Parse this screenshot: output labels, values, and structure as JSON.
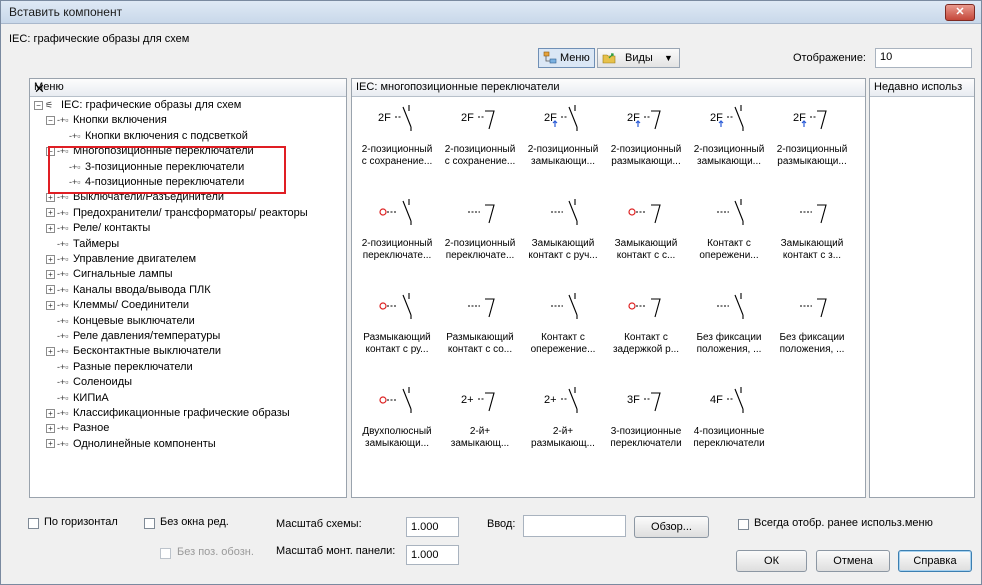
{
  "window": {
    "title": "Вставить компонент",
    "close_glyph": "✕"
  },
  "header": {
    "library_label": "IEC: графические образы для схем",
    "menu_button": "Меню",
    "views_button": "Виды",
    "display_label": "Отображение:",
    "display_value": "10"
  },
  "menu_panel": {
    "title": "Меню",
    "close_glyph": "✕",
    "items": [
      {
        "label": "IEC: графические образы для схем",
        "level": 0,
        "exp": "−"
      },
      {
        "label": "Кнопки включения",
        "level": 1,
        "exp": "−"
      },
      {
        "label": "Кнопки включения с подсветкой",
        "level": 2,
        "exp": ""
      },
      {
        "label": "Многопозиционные переключатели",
        "level": 1,
        "exp": "−"
      },
      {
        "label": "3-позиционные переключатели",
        "level": 2,
        "exp": ""
      },
      {
        "label": "4-позиционные переключатели",
        "level": 2,
        "exp": ""
      },
      {
        "label": "Выключатели/Разъединители",
        "level": 1,
        "exp": "+"
      },
      {
        "label": "Предохранители/ трансформаторы/ реакторы",
        "level": 1,
        "exp": "+"
      },
      {
        "label": "Реле/ контакты",
        "level": 1,
        "exp": "+"
      },
      {
        "label": "Таймеры",
        "level": 1,
        "exp": ""
      },
      {
        "label": "Управление двигателем",
        "level": 1,
        "exp": "+"
      },
      {
        "label": "Сигнальные лампы",
        "level": 1,
        "exp": "+"
      },
      {
        "label": "Каналы ввода/вывода ПЛК",
        "level": 1,
        "exp": "+"
      },
      {
        "label": "Клеммы/ Соединители",
        "level": 1,
        "exp": "+"
      },
      {
        "label": "Концевые выключатели",
        "level": 1,
        "exp": ""
      },
      {
        "label": "Реле давления/температуры",
        "level": 1,
        "exp": ""
      },
      {
        "label": "Бесконтактные выключатели",
        "level": 1,
        "exp": "+"
      },
      {
        "label": "Разные переключатели",
        "level": 1,
        "exp": ""
      },
      {
        "label": "Соленоиды",
        "level": 1,
        "exp": ""
      },
      {
        "label": "КИПиА",
        "level": 1,
        "exp": ""
      },
      {
        "label": "Классификационные графические образы",
        "level": 1,
        "exp": "+"
      },
      {
        "label": "Разное",
        "level": 1,
        "exp": "+"
      },
      {
        "label": "Однолинейные компоненты",
        "level": 1,
        "exp": "+"
      }
    ]
  },
  "gallery": {
    "title": "IEC: многопозиционные переключатели",
    "tiles": [
      {
        "line1": "2-позиционный",
        "line2": "с сохранение...",
        "icon": "switch-2pos-retain-nc-icon",
        "sym": "2F"
      },
      {
        "line1": "2-позиционный",
        "line2": "с сохранение...",
        "icon": "switch-2pos-retain-no-icon",
        "sym": "2F"
      },
      {
        "line1": "2-позиционный",
        "line2": "замыкающи...",
        "icon": "switch-2pos-make-icon",
        "sym": "2F"
      },
      {
        "line1": "2-позиционный",
        "line2": "размыкающи...",
        "icon": "switch-2pos-break-icon",
        "sym": "2F"
      },
      {
        "line1": "2-позиционный",
        "line2": "замыкающи...",
        "icon": "switch-2pos-make-arrow-icon",
        "sym": "2F"
      },
      {
        "line1": "2-позиционный",
        "line2": "размыкающи...",
        "icon": "switch-2pos-break-arrow-icon",
        "sym": "2F"
      },
      {
        "line1": "2-позиционный",
        "line2": "переключате...",
        "icon": "switch-key-make-icon",
        "sym": ""
      },
      {
        "line1": "2-позиционный",
        "line2": "переключате...",
        "icon": "switch-key-break-icon",
        "sym": ""
      },
      {
        "line1": "Замыкающий",
        "line2": "контакт с руч...",
        "icon": "contact-manual-make-icon",
        "sym": ""
      },
      {
        "line1": "Замыкающий",
        "line2": "контакт с с...",
        "icon": "contact-make-icon",
        "sym": ""
      },
      {
        "line1": "Контакт с",
        "line2": "опережени...",
        "icon": "contact-early-icon",
        "sym": ""
      },
      {
        "line1": "Замыкающий",
        "line2": "контакт с з...",
        "icon": "contact-delayed-make-icon",
        "sym": ""
      },
      {
        "line1": "Размыкающий",
        "line2": "контакт с ру...",
        "icon": "contact-manual-break-icon",
        "sym": ""
      },
      {
        "line1": "Размыкающий",
        "line2": "контакт с со...",
        "icon": "contact-break-icon",
        "sym": ""
      },
      {
        "line1": "Контакт с",
        "line2": "опережение...",
        "icon": "contact-early-break-icon",
        "sym": ""
      },
      {
        "line1": "Контакт с",
        "line2": "задержкой р...",
        "icon": "contact-delayed-break-icon",
        "sym": ""
      },
      {
        "line1": "Без фиксации",
        "line2": "положения, ...",
        "icon": "momentary-make-icon",
        "sym": ""
      },
      {
        "line1": "Без фиксации",
        "line2": "положения, ...",
        "icon": "momentary-break-icon",
        "sym": ""
      },
      {
        "line1": "Двухполюсный",
        "line2": "замыкающи...",
        "icon": "two-pole-make-icon",
        "sym": ""
      },
      {
        "line1": "2-й+",
        "line2": "замыкающ...",
        "icon": "second-make-icon",
        "sym": "2+"
      },
      {
        "line1": "2-й+",
        "line2": "размыкающ...",
        "icon": "second-break-icon",
        "sym": "2+"
      },
      {
        "line1": "3-позиционные",
        "line2": "переключатели",
        "icon": "switch-3pos-icon",
        "sym": "3F"
      },
      {
        "line1": "4-позиционные",
        "line2": "переключатели",
        "icon": "switch-4pos-icon",
        "sym": "4F"
      }
    ]
  },
  "recent_panel": {
    "title": "Недавно использ"
  },
  "footer": {
    "horizontal": "По горизонтал",
    "no_edit_window": "Без окна ред.",
    "no_pos_designation": "Без поз. обозн.",
    "schema_scale_label": "Масштаб схемы:",
    "schema_scale_value": "1.000",
    "panel_scale_label": "Масштаб монт. панели:",
    "panel_scale_value": "1.000",
    "input_label": "Ввод:",
    "input_value": "",
    "browse_button": "Обзор...",
    "always_show_label": "Всегда отобр. ранее использ.меню",
    "ok_button": "ОК",
    "cancel_button": "Отмена",
    "help_button": "Справка"
  }
}
